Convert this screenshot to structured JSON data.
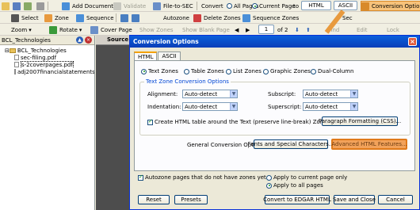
{
  "toolbar1": {
    "add_documents": "Add Documents",
    "validate": "Validate",
    "file_to_sec": "File-to-SEC",
    "convert_label": "Convert",
    "all_pages": "All Pages",
    "current_page": "Current Page",
    "to": "to",
    "html": "HTML",
    "ascii": "ASCII",
    "conversion_options": "Conversion Options"
  },
  "toolbar2": {
    "select": "Select",
    "zone": "Zone",
    "sequence": "Sequence",
    "autozone": "Autozone",
    "delete_zones": "Delete Zones",
    "sequence_zones": "Sequence Zones",
    "sec_partial": "Sec"
  },
  "toolbar3": {
    "zoom": "Zoom",
    "rotate": "Rotate",
    "cover_page": "Cover Page",
    "show_zones": "Show Zones",
    "show_blank_page": "Show Blank Page",
    "page_value": "1",
    "of_pages": "of 2",
    "find": "Find",
    "edit": "Edit",
    "lock": "Lock"
  },
  "left_panel": {
    "title": "BCL_Technologies",
    "tree": [
      {
        "label": "BCL_Technologies",
        "type": "folder"
      },
      {
        "label": "sec-filing.pdf",
        "type": "file"
      },
      {
        "label": "s-2coverpages.pdf",
        "type": "file"
      },
      {
        "label": "adj2007financialstatements.p",
        "type": "file"
      }
    ]
  },
  "source_header": "Source",
  "dialog": {
    "title": "Conversion Options",
    "tabs": [
      "HTML",
      "ASCII"
    ],
    "zone_types": [
      "Text Zones",
      "Table Zones",
      "List Zones",
      "Graphic Zones",
      "Dual-Column"
    ],
    "group_label": "Text Zone Conversion Options",
    "alignment_label": "Alignment:",
    "alignment_value": "Auto-detect",
    "indentation_label": "Indentation:",
    "indentation_value": "Auto-detect",
    "subscript_label": "Subscript:",
    "subscript_value": "Auto-detect",
    "superscript_label": "Superscript:",
    "superscript_value": "Auto-detect",
    "create_table_label": "Create HTML table around the Text (preserve line-break) Zones",
    "paragraph_button": "Paragraph Formatting (CSS)...",
    "general_label": "General Conversion Options:",
    "fonts_button": "Fonts and Special Characters...",
    "advanced_button": "Advanced HTML Features...",
    "autozone_label": "Autozone pages that do not have zones yet.",
    "apply_current": "Apply to current page only",
    "apply_all": "Apply to all pages",
    "reset_button": "Reset",
    "presets_button": "Presets",
    "edgar_button": "Convert to EDGAR HTML",
    "save_close_button": "Save and Close",
    "cancel_button": "Cancel"
  },
  "colors": {
    "title_bar": "#0a5fdb",
    "highlight": "#f2a25a",
    "accent_green": "#21a121"
  }
}
